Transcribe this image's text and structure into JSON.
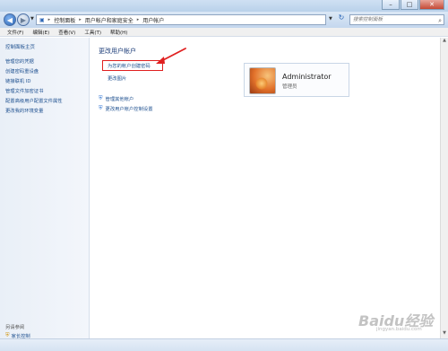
{
  "window": {
    "title_controls": [
      "–",
      "□",
      "✕"
    ]
  },
  "address": {
    "crumbs": [
      "控制面板",
      "用户帐户和家庭安全",
      "用户帐户"
    ],
    "search_placeholder": "搜索控制面板"
  },
  "menu": [
    "文件(F)",
    "编辑(E)",
    "查看(V)",
    "工具(T)",
    "帮助(H)"
  ],
  "sidebar": {
    "home": "控制面板主页",
    "links": [
      "管理您的凭据",
      "创建密码重设盘",
      "链接联机 ID",
      "管理文件加密证书",
      "配置高级用户配置文件属性",
      "更改我的环境变量"
    ],
    "see_also": "另请参阅",
    "family_safety": "家长控制"
  },
  "main": {
    "title": "更改用户帐户",
    "create_password": "为您的帐户创建密码",
    "change_picture": "更改图片",
    "manage_other": "管理其他帐户",
    "uac_settings": "更改用户帐户控制设置"
  },
  "account": {
    "name": "Administrator",
    "role": "管理员"
  },
  "watermark": {
    "text": "Baidu经验",
    "sub": "jingyan.baidu.com"
  },
  "colors": {
    "link": "#1d4f8f",
    "highlight_box": "#e02020",
    "arrow": "#e02020"
  }
}
